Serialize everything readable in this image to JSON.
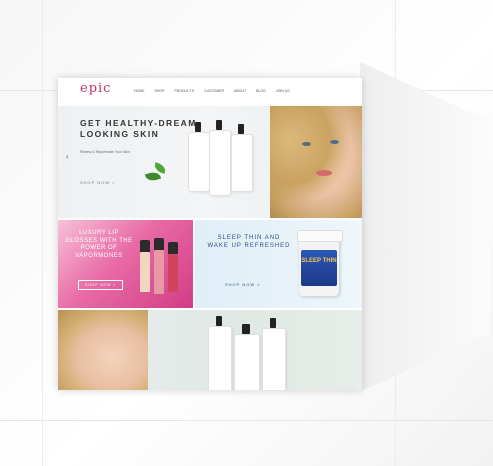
{
  "site": {
    "logo": {
      "text": "epic",
      "tagline": ""
    },
    "nav": {
      "items": [
        "HOME",
        "SHOP",
        "PRODUCTS",
        "CUSTOMER",
        "ABOUT",
        "BLOG",
        "JOIN US"
      ]
    },
    "hero": {
      "title": "GET HEALTHY-DREAM LOOKING SKIN",
      "subtitle": "Renew & Rejuvenate Your Skin",
      "cta": "SHOP NOW >"
    },
    "promo_left": {
      "title": "LUXURY LIP GLOSSES WITH THE POWER OF VAPORMONES",
      "cta": "SHOP NOW >"
    },
    "promo_right": {
      "title": "SLEEP THIN AND WAKE UP REFRESHED",
      "cta": "SHOP NOW >",
      "jar_label": "SLEEP THIN"
    }
  },
  "colors": {
    "brand": "#c0306b",
    "promo_pink": "#d13d86",
    "promo_blue": "#2b4e8a"
  }
}
